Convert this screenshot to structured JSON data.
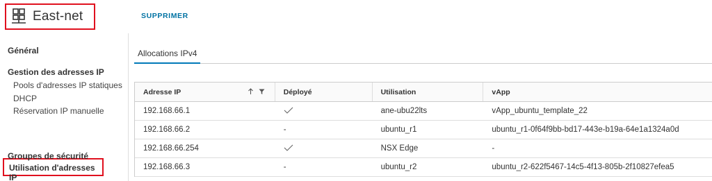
{
  "header": {
    "title": "East-net",
    "action_label": "SUPPRIMER"
  },
  "sidebar": {
    "general": "Général",
    "ip_management": "Gestion des adresses IP",
    "sub_items": [
      "Pools d'adresses IP statiques",
      "DHCP",
      "Réservation IP manuelle"
    ],
    "ip_usage": "Utilisation d'adresses IP",
    "security_groups": "Groupes de sécurité"
  },
  "tabs": [
    "Allocations IPv4"
  ],
  "table": {
    "columns": [
      "Adresse IP",
      "Déployé",
      "Utilisation",
      "vApp"
    ],
    "rows": [
      {
        "ip": "192.168.66.1",
        "deployed": "check",
        "usage": "ane-ubu22lts",
        "vapp": "vApp_ubuntu_template_22"
      },
      {
        "ip": "192.168.66.2",
        "deployed": "-",
        "usage": "ubuntu_r1",
        "vapp": "ubuntu_r1-0f64f9bb-bd17-443e-b19a-64e1a1324a0d"
      },
      {
        "ip": "192.168.66.254",
        "deployed": "check",
        "usage": "NSX Edge",
        "vapp": "-"
      },
      {
        "ip": "192.168.66.3",
        "deployed": "-",
        "usage": "ubuntu_r2",
        "vapp": "ubuntu_r2-622f5467-14c5-4f13-805b-2f10827efea5"
      }
    ]
  },
  "icons": {
    "network": "network-icon",
    "sort": "sort-arrow-up-icon",
    "filter": "filter-icon",
    "check": "checkmark-icon"
  },
  "colors": {
    "highlight_border": "#e0101e",
    "link": "#0072a3",
    "tab_underline": "#0079b8"
  }
}
